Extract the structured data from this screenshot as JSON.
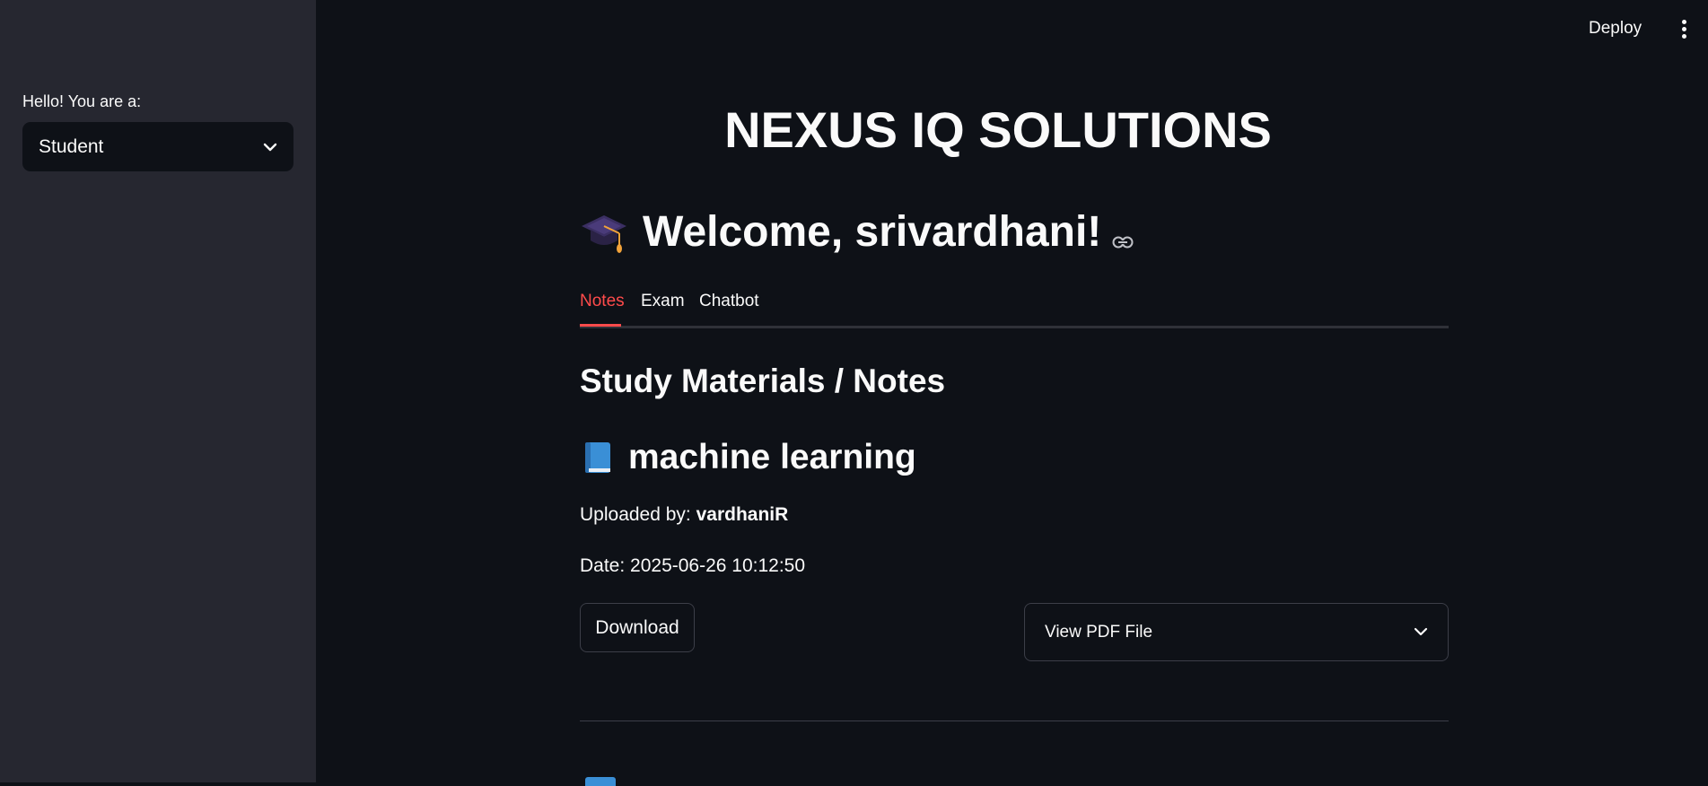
{
  "sidebar": {
    "role_label": "Hello! You are a:",
    "role_selected": "Student"
  },
  "topbar": {
    "deploy_label": "Deploy"
  },
  "brand": {
    "title": "NEXUS IQ SOLUTIONS"
  },
  "welcome": {
    "text": "Welcome, srivardhani!"
  },
  "tabs": [
    {
      "label": "Notes",
      "active": true
    },
    {
      "label": "Exam",
      "active": false
    },
    {
      "label": "Chatbot",
      "active": false
    }
  ],
  "notes": {
    "section_title": "Study Materials / Notes",
    "items": [
      {
        "title": "machine learning",
        "uploaded_by_label": "Uploaded by: ",
        "uploaded_by": "vardhaniR",
        "date_label": "Date: 2025-06-26 10:12:50",
        "download_label": "Download",
        "view_pdf_label": "View PDF File"
      }
    ]
  },
  "colors": {
    "background": "#0e1117",
    "sidebar": "#262730",
    "accent": "#ff4b4b"
  }
}
